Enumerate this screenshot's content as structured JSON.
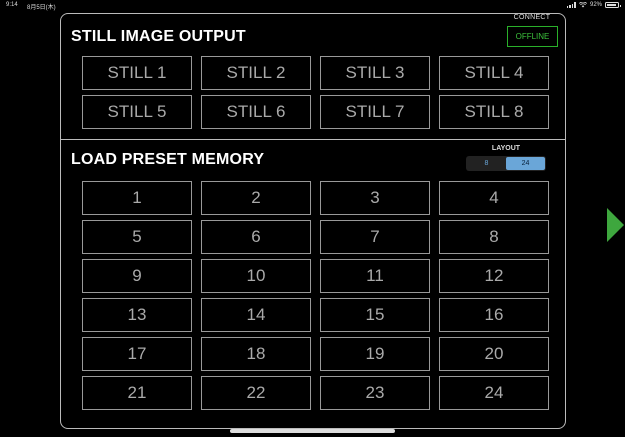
{
  "status_bar": {
    "time": "9:14",
    "date": "8月5日(木)",
    "battery": "92%"
  },
  "still_output": {
    "title": "STILL IMAGE OUTPUT",
    "connect_label": "CONNECT",
    "connection_status": "OFFLINE",
    "buttons": [
      "STILL 1",
      "STILL 2",
      "STILL 3",
      "STILL 4",
      "STILL 5",
      "STILL 6",
      "STILL 7",
      "STILL 8"
    ]
  },
  "preset_memory": {
    "title": "LOAD PRESET MEMORY",
    "layout_label": "LAYOUT",
    "layout_options": [
      "8",
      "24"
    ],
    "layout_selected": "24",
    "buttons": [
      "1",
      "2",
      "3",
      "4",
      "5",
      "6",
      "7",
      "8",
      "9",
      "10",
      "11",
      "12",
      "13",
      "14",
      "15",
      "16",
      "17",
      "18",
      "19",
      "20",
      "21",
      "22",
      "23",
      "24"
    ]
  },
  "colors": {
    "accent_green": "#3ea73e",
    "layout_blue": "#6aa6d8",
    "border_gray": "#999999"
  },
  "icons": {
    "next_page": "green-right-triangle-icon"
  }
}
